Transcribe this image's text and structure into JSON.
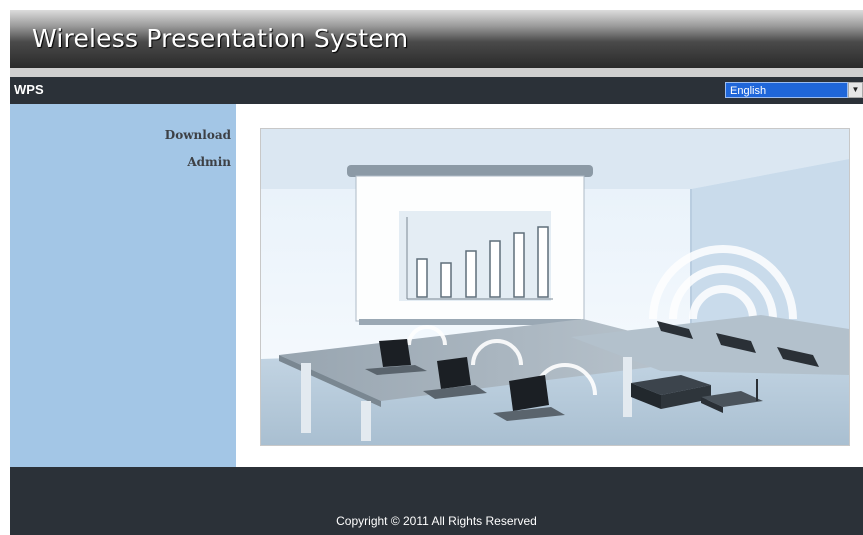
{
  "header": {
    "title": "Wireless Presentation System"
  },
  "navbar": {
    "brand": "WPS",
    "language": {
      "selected": "English"
    }
  },
  "sidebar": {
    "items": [
      {
        "label": "Download"
      },
      {
        "label": "Admin"
      }
    ]
  },
  "main": {
    "hero_image": "presentation-room-illustration"
  },
  "footer": {
    "copyright": "Copyright © 2011  All Rights Reserved"
  },
  "colors": {
    "navbar": "#2b3138",
    "sidebar": "#a3c6e6",
    "select": "#1f66d9",
    "link": "#3d4045"
  }
}
